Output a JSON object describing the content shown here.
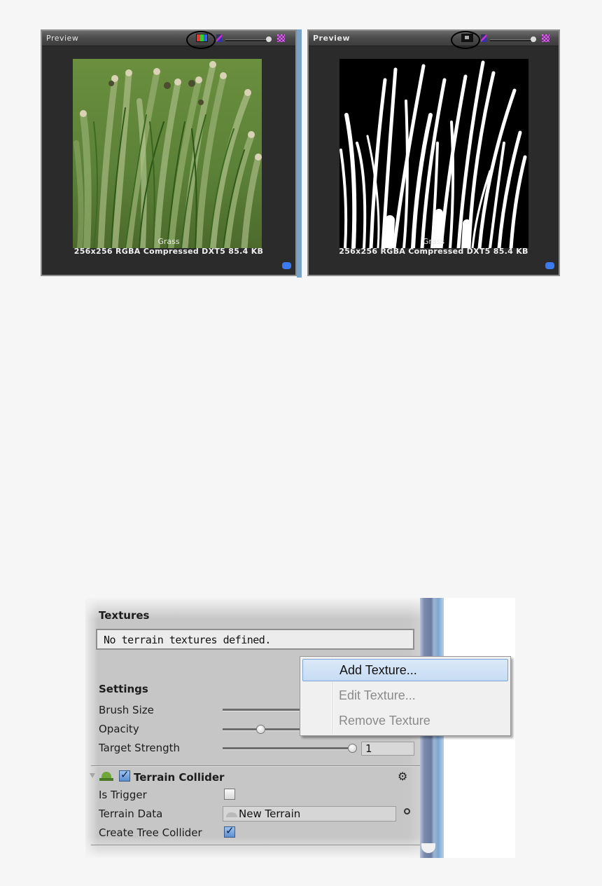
{
  "previews": [
    {
      "title": "Preview",
      "channel_mode": "RGB",
      "channel_icon": "rgb-channels-icon",
      "texture_name": "Grass",
      "texture_info": "256x256  RGBA Compressed DXT5   85.4 KB",
      "zoom_slider_value": 1.0
    },
    {
      "title": "Preview",
      "channel_mode": "Alpha",
      "channel_icon": "alpha-channel-icon",
      "texture_name": "Grass",
      "texture_info": "256x256  RGBA Compressed DXT5   85.4 KB",
      "zoom_slider_value": 1.0
    }
  ],
  "inspector": {
    "textures": {
      "heading": "Textures",
      "empty_message": "No terrain textures defined."
    },
    "context_menu": {
      "items": [
        {
          "label": "Add Texture...",
          "enabled": true,
          "highlighted": true
        },
        {
          "label": "Edit Texture...",
          "enabled": false,
          "highlighted": false
        },
        {
          "label": "Remove Texture",
          "enabled": false,
          "highlighted": false
        }
      ]
    },
    "settings": {
      "heading": "Settings",
      "brush_size_label": "Brush Size",
      "opacity_label": "Opacity",
      "opacity_value_fraction": 0.3,
      "target_strength_label": "Target Strength",
      "target_strength_value": "1"
    },
    "terrain_collider": {
      "title": "Terrain Collider",
      "enabled": true,
      "is_trigger_label": "Is Trigger",
      "is_trigger": false,
      "terrain_data_label": "Terrain Data",
      "terrain_data_value": "New Terrain",
      "create_tree_collider_label": "Create Tree Collider",
      "create_tree_collider": true
    }
  },
  "colors": {
    "preview_bg": "#2b2b2b",
    "grass_bg": "#5b8038",
    "menu_highlight": "#c6dcf4",
    "scrollbar": "#7aa6d0",
    "checkbox_checked": "#5c8fd0"
  }
}
